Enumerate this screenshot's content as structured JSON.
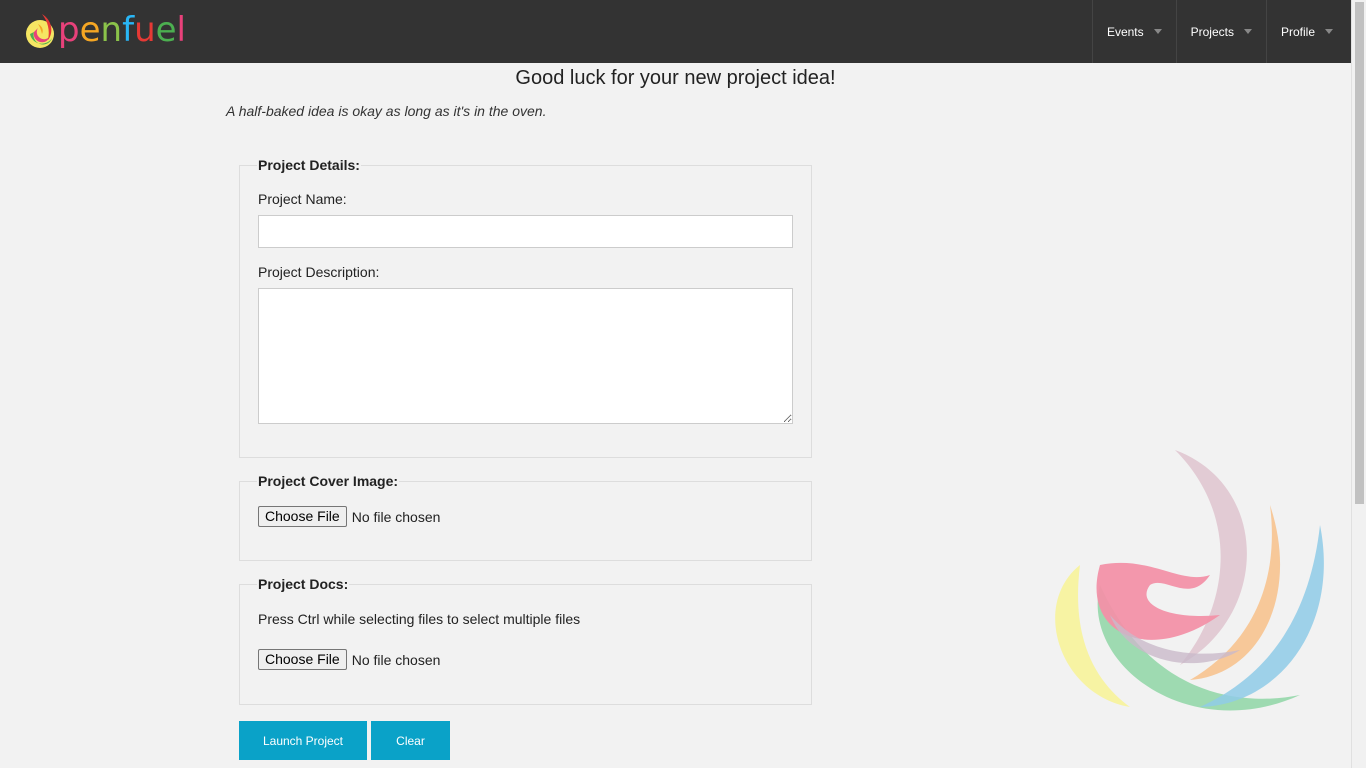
{
  "header": {
    "logo_text": "penfuel",
    "nav": [
      {
        "label": "Events"
      },
      {
        "label": "Projects"
      },
      {
        "label": "Profile"
      }
    ]
  },
  "page": {
    "title": "Good luck for your new project idea!",
    "tagline": "A half-baked idea is okay as long as it's in the oven."
  },
  "form": {
    "details": {
      "legend": "Project Details:",
      "name_label": "Project Name:",
      "name_value": "",
      "description_label": "Project Description:",
      "description_value": ""
    },
    "cover": {
      "legend": "Project Cover Image:",
      "button_label": "Choose File",
      "status": "No file chosen"
    },
    "docs": {
      "legend": "Project Docs:",
      "hint": "Press Ctrl while selecting files to select multiple files",
      "button_label": "Choose File",
      "status": "No file chosen"
    },
    "actions": {
      "launch_label": "Launch Project",
      "clear_label": "Clear"
    }
  },
  "colors": {
    "topbar": "#333333",
    "accent_button": "#0aa2c8",
    "logo_letters": [
      "#e8417a",
      "#f5a623",
      "#8bc34a",
      "#29b6f6",
      "#e53935",
      "#4caf50"
    ]
  }
}
